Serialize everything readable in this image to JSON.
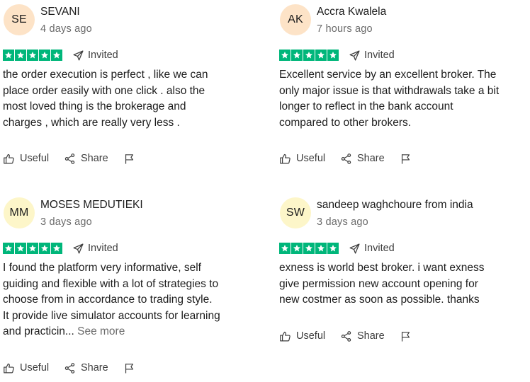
{
  "reviews": [
    {
      "initials": "SE",
      "avatar_color": "#fde3c7",
      "name": "SEVANI",
      "date": "4 days ago",
      "rating": 5,
      "badge": "Invited",
      "lines": [
        "the order execution is perfect , like we can",
        "place order easily with one click . also the",
        "most loved thing is the brokerage and",
        "charges , which are really very less ."
      ],
      "see_more": "",
      "useful_label": "Useful",
      "share_label": "Share"
    },
    {
      "initials": "AK",
      "avatar_color": "#fde3c7",
      "name": "Accra Kwalela",
      "date": "7 hours ago",
      "rating": 5,
      "badge": "Invited",
      "lines": [
        "Excellent service by an excellent broker. The",
        "only major issue is that withdrawals take a bit",
        "longer to reflect in the bank account",
        "compared to other brokers."
      ],
      "see_more": "",
      "useful_label": "Useful",
      "share_label": "Share"
    },
    {
      "initials": "MM",
      "avatar_color": "#fdf6c9",
      "name": "MOSES MEDUTIEKI",
      "date": "3 days ago",
      "rating": 5,
      "badge": "Invited",
      "lines": [
        "I found the platform very informative, self",
        "guiding and flexible with a lot of strategies to",
        "choose from in accordance to trading style.",
        "It provide live simulator accounts for learning",
        "and practicin..."
      ],
      "see_more": "See more",
      "useful_label": "Useful",
      "share_label": "Share"
    },
    {
      "initials": "SW",
      "avatar_color": "#fdf6c9",
      "name": "sandeep waghchoure from india",
      "date": "3 days ago",
      "rating": 5,
      "badge": "Invited",
      "lines": [
        "exness is world best broker. i want exness",
        "give permission new account opening for",
        "new costmer as soon as possible. thanks"
      ],
      "see_more": "",
      "useful_label": "Useful",
      "share_label": "Share"
    }
  ],
  "icons": {
    "star": "star-icon",
    "invited": "send-icon",
    "useful": "thumbs-up-icon",
    "share": "share-icon",
    "report": "flag-icon"
  },
  "colors": {
    "star_green": "#00b67a",
    "muted_text": "#6b6b6b"
  }
}
